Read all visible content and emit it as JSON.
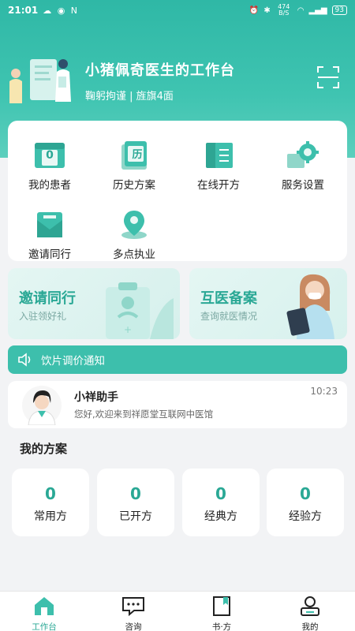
{
  "status_bar": {
    "time": "21:01",
    "left_icons": "☁ ◉ N",
    "net_rate": "474 B/S",
    "battery": "93"
  },
  "profile": {
    "title": "小猪佩奇医生的工作台",
    "subtitle": "鞠躬拘谨 | 旌旗4面"
  },
  "menu": {
    "items": [
      {
        "label": "我的患者",
        "badge": "0"
      },
      {
        "label": "历史方案",
        "badge": "历"
      },
      {
        "label": "在线开方"
      },
      {
        "label": "服务设置"
      },
      {
        "label": "邀请同行"
      },
      {
        "label": "多点执业"
      }
    ]
  },
  "promos": [
    {
      "title": "邀请同行",
      "subtitle": "入驻领好礼"
    },
    {
      "title": "互医备案",
      "subtitle": "查询就医情况"
    }
  ],
  "notice": {
    "text": "饮片调价通知"
  },
  "message": {
    "name": "小祥助手",
    "text": "您好,欢迎来到祥愿堂互联网中医馆",
    "time": "10:23"
  },
  "section": {
    "title": "我的方案"
  },
  "stats": [
    {
      "value": "0",
      "label": "常用方"
    },
    {
      "value": "0",
      "label": "已开方"
    },
    {
      "value": "0",
      "label": "经典方"
    },
    {
      "value": "0",
      "label": "经验方"
    }
  ],
  "tabbar": {
    "active": 0,
    "tabs": [
      {
        "label": "工作台",
        "icon": "home-icon"
      },
      {
        "label": "咨询",
        "icon": "chat-icon"
      },
      {
        "label": "书·方",
        "icon": "book-icon"
      },
      {
        "label": "我的",
        "icon": "user-icon"
      }
    ]
  },
  "colors": {
    "primary": "#3dbfac",
    "accent_text": "#2aa895",
    "background": "#f2f3f5"
  }
}
